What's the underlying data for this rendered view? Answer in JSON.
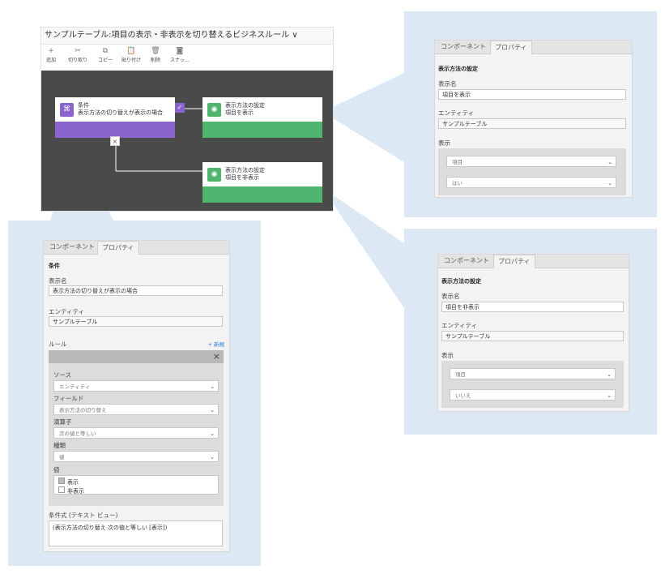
{
  "designer": {
    "title": "サンプルテーブル:項目の表示・非表示を切り替えるビジネスルール ∨",
    "toolbar": [
      {
        "icon": "plus-icon",
        "glyph": "+",
        "label": "追加"
      },
      {
        "icon": "scissors-icon",
        "glyph": "✂",
        "label": "切り取り"
      },
      {
        "icon": "copy-icon",
        "glyph": "⧉",
        "label": "コピー"
      },
      {
        "icon": "paste-icon",
        "glyph": "📋",
        "label": "貼り付け"
      },
      {
        "icon": "delete-icon",
        "glyph": "🗑",
        "label": "削除"
      },
      {
        "icon": "snapshot-icon",
        "glyph": "◙",
        "label": "スナッ..."
      }
    ],
    "condition_node": {
      "line1": "条件",
      "line2": "表示方法の切り替えが表示の場合"
    },
    "true_node": {
      "line1": "表示方法の設定",
      "line2": "項目を表示"
    },
    "false_node": {
      "line1": "表示方法の設定",
      "line2": "項目を非表示"
    },
    "colors": {
      "condition": "#8a65cd",
      "action": "#4fb46d",
      "canvas": "#4a4a4a",
      "callout": "#dde8f5"
    }
  },
  "panel_condition": {
    "tab_component": "コンポーネント",
    "tab_property": "プロパティ",
    "title": "条件",
    "display_name_label": "表示名",
    "display_name_value": "表示方法の切り替えが表示の場合",
    "entity_label": "エンティティ",
    "entity_value": "サンプルテーブル",
    "rule_label": "ルール",
    "new_link": "+ 新規",
    "close_glyph": "×",
    "source_label": "ソース",
    "source_value": "エンティティ",
    "field_label": "フィールド",
    "field_value": "表示方法の切り替え",
    "operator_label": "演算子",
    "operator_value": "次の値と等しい",
    "type_label": "種類",
    "type_value": "値",
    "value_label": "値",
    "option_show": "表示",
    "option_hide": "非表示",
    "expression_label": "条件式 (テキスト ビュー)",
    "expression_value": "(表示方法の切り替え 次の値と等しい [表示])"
  },
  "panel_show": {
    "tab_component": "コンポーネント",
    "tab_property": "プロパティ",
    "title": "表示方法の設定",
    "display_name_label": "表示名",
    "display_name_value": "項目を表示",
    "entity_label": "エンティティ",
    "entity_value": "サンプルテーブル",
    "visibility_label": "表示",
    "field_select": "項目",
    "value_select": "はい"
  },
  "panel_hide": {
    "tab_component": "コンポーネント",
    "tab_property": "プロパティ",
    "title": "表示方法の設定",
    "display_name_label": "表示名",
    "display_name_value": "項目を非表示",
    "entity_label": "エンティティ",
    "entity_value": "サンプルテーブル",
    "visibility_label": "表示",
    "field_select": "項目",
    "value_select": "いいえ"
  }
}
